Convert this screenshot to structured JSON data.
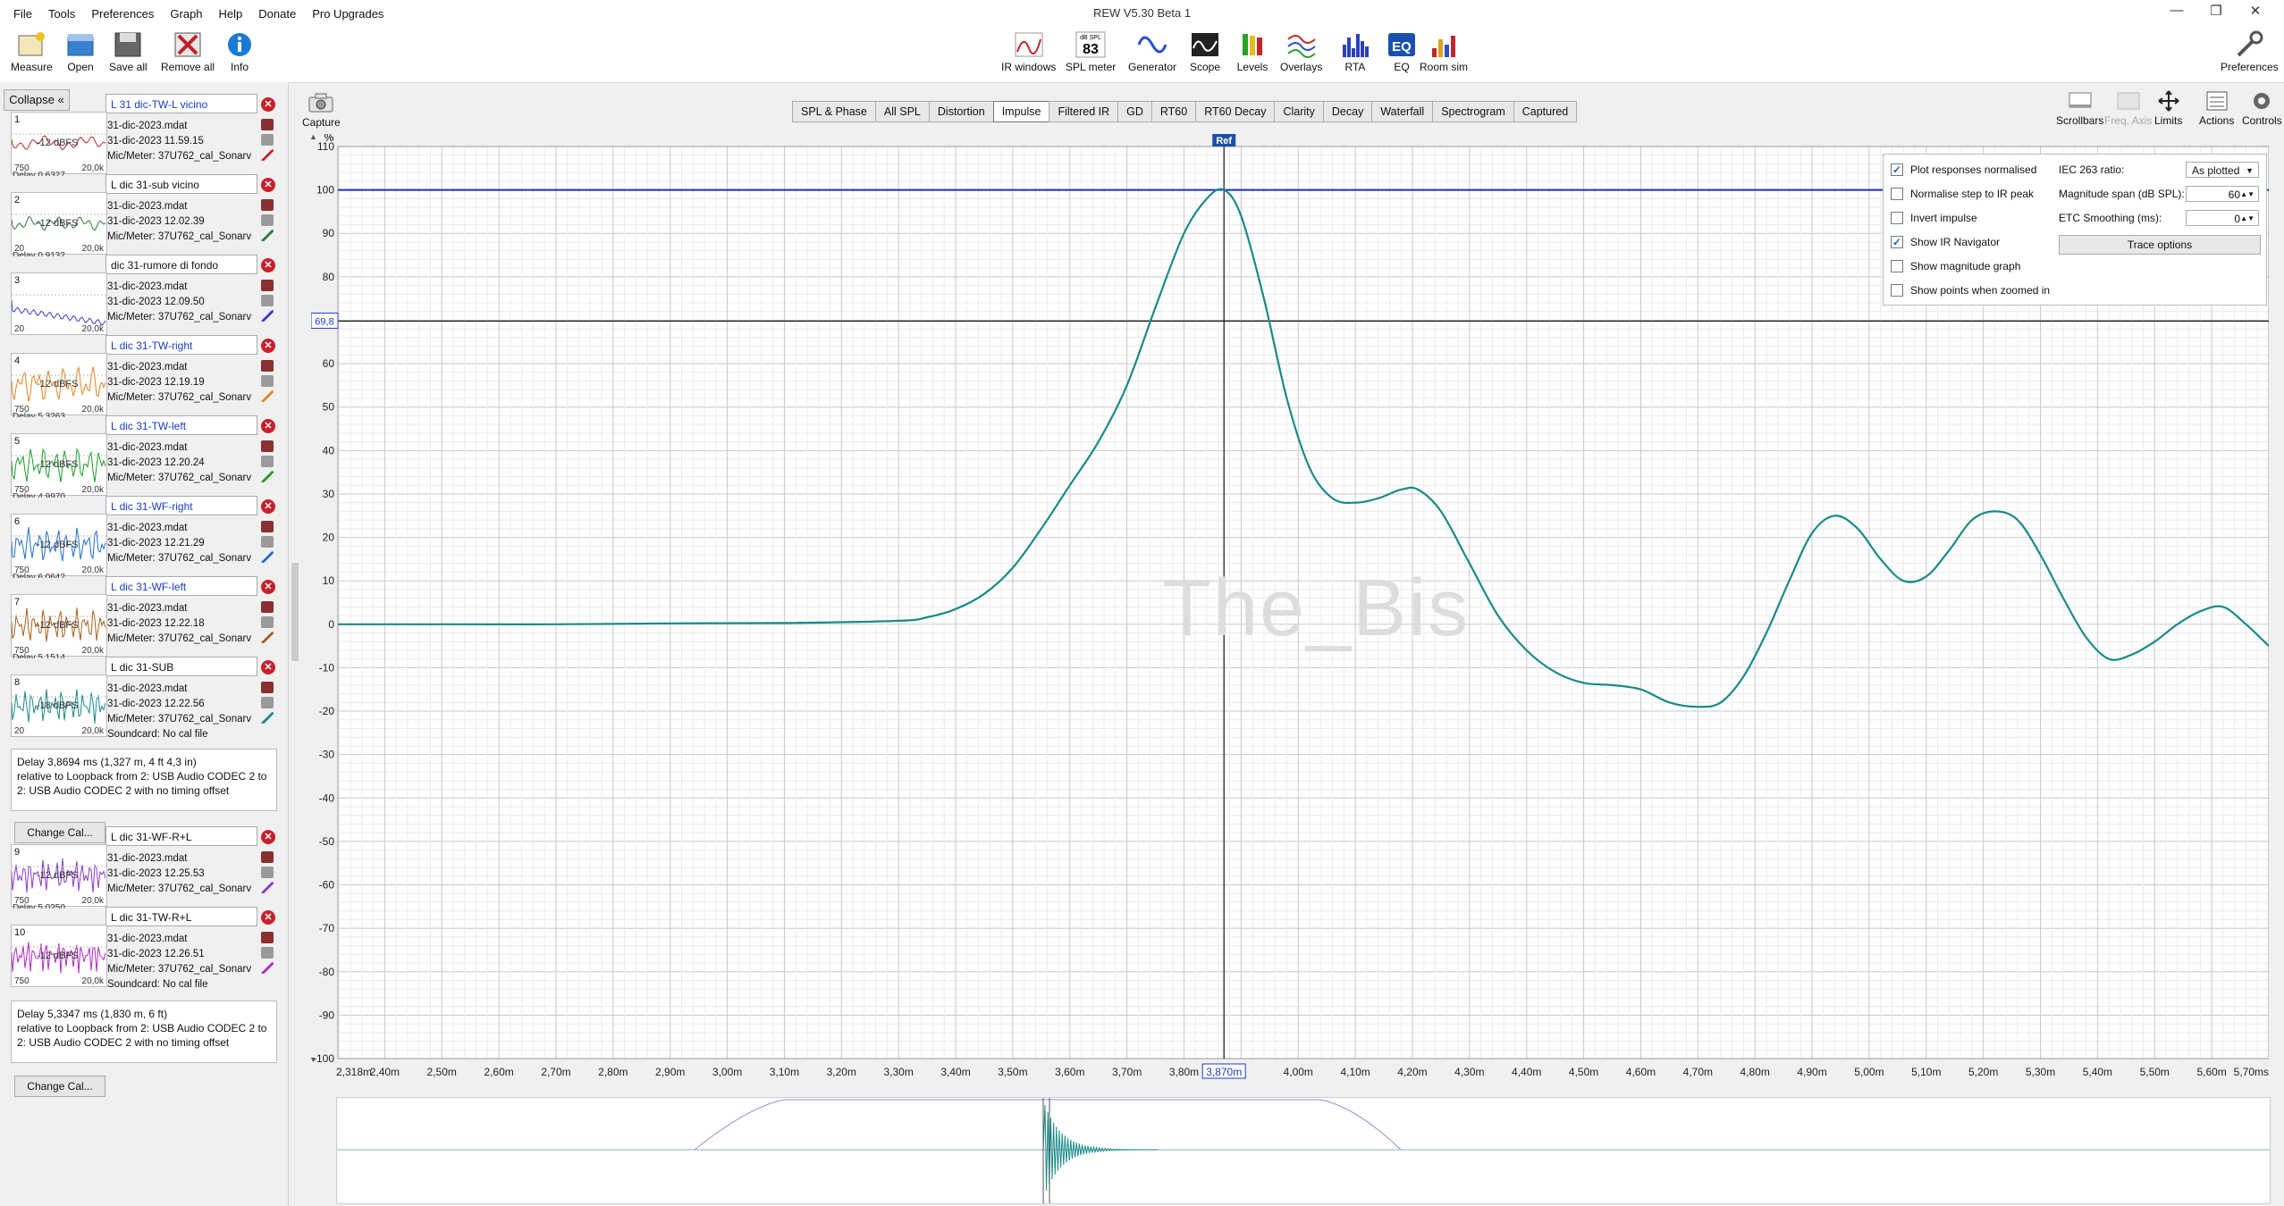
{
  "window": {
    "title": "REW V5.30 Beta 1",
    "controls": [
      "—",
      "❐",
      "✕"
    ]
  },
  "menu": [
    "File",
    "Tools",
    "Preferences",
    "Graph",
    "Help",
    "Donate",
    "Pro Upgrades"
  ],
  "toolbar_left": [
    {
      "label": "Measure",
      "icon": "measure-icon"
    },
    {
      "label": "Open",
      "icon": "open-icon"
    },
    {
      "label": "Save all",
      "icon": "save-icon"
    },
    {
      "label": "Remove all",
      "icon": "remove-icon"
    },
    {
      "label": "Info",
      "icon": "info-icon"
    }
  ],
  "toolbar_center": [
    {
      "label": "IR windows",
      "icon": "ir-windows-icon"
    },
    {
      "label": "SPL meter",
      "icon": "spl-meter-icon",
      "value": "83",
      "unit": "dB SPL"
    },
    {
      "label": "Generator",
      "icon": "generator-icon"
    },
    {
      "label": "Scope",
      "icon": "scope-icon"
    },
    {
      "label": "Levels",
      "icon": "levels-icon"
    },
    {
      "label": "Overlays",
      "icon": "overlays-icon"
    },
    {
      "label": "RTA",
      "icon": "rta-icon"
    },
    {
      "label": "EQ",
      "icon": "eq-icon"
    },
    {
      "label": "Room sim",
      "icon": "room-sim-icon"
    }
  ],
  "toolbar_right": {
    "label": "Preferences",
    "icon": "preferences-icon"
  },
  "left_panel": {
    "collapse_label": "Collapse",
    "collapse_icon": "«",
    "change_cal_label": "Change Cal...",
    "measurements": [
      {
        "num": "1",
        "name": "L 31 dic-TW-L vicino",
        "blue": true,
        "color": "#c0262c",
        "dbfs": "-12 dBFS",
        "ax_l": "750",
        "ax_r": "20,0k",
        "file": "31-dic-2023.mdat",
        "date": "31-dic-2023 11.59.15",
        "mic": "Mic/Meter: 37U762_cal_Sonarv",
        "delay": "Delay 0,6327"
      },
      {
        "num": "2",
        "name": "L dic 31-sub vicino",
        "blue": false,
        "color": "#2c7a3a",
        "dbfs": "-12 dBFS",
        "ax_l": "20",
        "ax_r": "20,0k",
        "file": "31-dic-2023.mdat",
        "date": "31-dic-2023 12.02.39",
        "mic": "Mic/Meter: 37U762_cal_Sonarv",
        "delay": "Delay 0,9132"
      },
      {
        "num": "3",
        "name": "dic 31-rumore di fondo",
        "blue": false,
        "color": "#3a3ad0",
        "dbfs": "",
        "ax_l": "20",
        "ax_r": "20,0k",
        "file": "31-dic-2023.mdat",
        "date": "31-dic-2023 12.09.50",
        "mic": "Mic/Meter: 37U762_cal_Sonarv",
        "delay": ""
      },
      {
        "num": "4",
        "name": "L dic 31-TW-right",
        "blue": true,
        "color": "#e8821e",
        "dbfs": "-12 dBFS",
        "ax_l": "750",
        "ax_r": "20,0k",
        "file": "31-dic-2023.mdat",
        "date": "31-dic-2023 12.19.19",
        "mic": "Mic/Meter: 37U762_cal_Sonarv",
        "delay": "Delay 5,3263"
      },
      {
        "num": "5",
        "name": "L dic 31-TW-left",
        "blue": true,
        "color": "#1e9c2a",
        "dbfs": "-12 dBFS",
        "ax_l": "750",
        "ax_r": "20,0k",
        "file": "31-dic-2023.mdat",
        "date": "31-dic-2023 12.20.24",
        "mic": "Mic/Meter: 37U762_cal_Sonarv",
        "delay": "Delay 4,9970"
      },
      {
        "num": "6",
        "name": "L dic 31-WF-right",
        "blue": true,
        "color": "#1e6ed0",
        "dbfs": "-12 dBFS",
        "ax_l": "750",
        "ax_r": "20,0k",
        "file": "31-dic-2023.mdat",
        "date": "31-dic-2023 12.21.29",
        "mic": "Mic/Meter: 37U762_cal_Sonarv",
        "delay": "Delay 6,0642"
      },
      {
        "num": "7",
        "name": "L dic 31-WF-left",
        "blue": true,
        "color": "#a8601e",
        "dbfs": "-12 dBFS",
        "ax_l": "750",
        "ax_r": "20,0k",
        "file": "31-dic-2023.mdat",
        "date": "31-dic-2023 12.22.18",
        "mic": "Mic/Meter: 37U762_cal_Sonarv",
        "delay": "Delay 5,1514"
      },
      {
        "num": "8",
        "name": "L dic 31-SUB",
        "blue": false,
        "color": "#1a8a8a",
        "dbfs": "-18 dBFS",
        "ax_l": "20",
        "ax_r": "20,0k",
        "file": "31-dic-2023.mdat",
        "date": "31-dic-2023 12.22.56",
        "mic": "Mic/Meter: 37U762_cal_Sonarv",
        "soundcard": "Soundcard: No cal file",
        "delay": ""
      },
      {
        "num": "9",
        "name": "L dic 31-WF-R+L",
        "blue": false,
        "color": "#8a3ad0",
        "dbfs": "-12 dBFS",
        "ax_l": "750",
        "ax_r": "20,0k",
        "file": "31-dic-2023.mdat",
        "date": "31-dic-2023 12.25.53",
        "mic": "Mic/Meter: 37U762_cal_Sonarv",
        "delay": "Delay 5,0250"
      },
      {
        "num": "10",
        "name": "L dic 31-TW-R+L",
        "blue": false,
        "color": "#b02ac0",
        "dbfs": "-12 dBFS",
        "ax_l": "750",
        "ax_r": "20,0k",
        "file": "31-dic-2023.mdat",
        "date": "31-dic-2023 12.26.51",
        "mic": "Mic/Meter: 37U762_cal_Sonarv",
        "soundcard": "Soundcard: No cal file",
        "delay": ""
      }
    ],
    "detail_8": [
      "Delay 3,8694 ms (1,327 m, 4 ft 4,3 in)",
      " relative to Loopback from 2: USB Audio CODEC  2 to",
      "2: USB Audio CODEC  2 with no timing offset"
    ],
    "detail_10": [
      "Delay 5,3347 ms (1,830 m, 6 ft)",
      " relative to Loopback from 2: USB Audio CODEC  2 to",
      "2: USB Audio CODEC  2 with no timing offset"
    ]
  },
  "capture_label": "Capture",
  "tabs": [
    "SPL & Phase",
    "All SPL",
    "Distortion",
    "Impulse",
    "Filtered IR",
    "GD",
    "RT60",
    "RT60 Decay",
    "Clarity",
    "Decay",
    "Waterfall",
    "Spectrogram",
    "Captured"
  ],
  "active_tab": "Impulse",
  "right_tools": [
    {
      "label": "Scrollbars",
      "icon": "scrollbars-icon",
      "disabled": false
    },
    {
      "label": "Freq. Axis",
      "icon": "freq-axis-icon",
      "disabled": true
    },
    {
      "label": "Limits",
      "icon": "limits-icon",
      "disabled": false
    },
    {
      "label": "Actions",
      "icon": "actions-icon",
      "disabled": false
    },
    {
      "label": "Controls",
      "icon": "controls-icon",
      "disabled": false
    }
  ],
  "options": {
    "left": [
      {
        "label": "Plot responses normalised",
        "checked": true
      },
      {
        "label": "Normalise step to IR peak",
        "checked": false
      },
      {
        "label": "Invert impulse",
        "checked": false
      },
      {
        "label": "Show IR Navigator",
        "checked": true
      },
      {
        "label": "Show magnitude graph",
        "checked": false
      },
      {
        "label": "Show points when zoomed in",
        "checked": false
      }
    ],
    "iec_label": "IEC 263 ratio:",
    "iec_value": "As plotted",
    "mag_label": "Magnitude span (dB SPL):",
    "mag_value": "60",
    "etc_label": "ETC Smoothing (ms):",
    "etc_value": "0",
    "trace_button": "Trace options"
  },
  "watermark": "The_Bis",
  "chart_data": {
    "type": "line",
    "ylabel": "%",
    "ylim": [
      -100,
      110
    ],
    "xlim": [
      2.318,
      5.7
    ],
    "y_ticks": [
      110,
      100,
      90,
      80,
      70,
      60,
      50,
      40,
      30,
      20,
      10,
      0,
      -10,
      -20,
      -30,
      -40,
      -50,
      -60,
      -70,
      -80,
      -90,
      -100
    ],
    "x_ticks": [
      "2,318m",
      "2,40m",
      "2,50m",
      "2,60m",
      "2,70m",
      "2,80m",
      "2,90m",
      "3,00m",
      "3,10m",
      "3,20m",
      "3,30m",
      "3,40m",
      "3,50m",
      "3,60m",
      "3,70m",
      "3,80m",
      "3,870m",
      "4,00m",
      "4,10m",
      "4,20m",
      "4,30m",
      "4,40m",
      "4,50m",
      "4,60m",
      "4,70m",
      "4,80m",
      "4,90m",
      "5,00m",
      "5,10m",
      "5,20m",
      "5,30m",
      "5,40m",
      "5,50m",
      "5,60m",
      "5,70ms"
    ],
    "x_tick_values": [
      2.318,
      2.4,
      2.5,
      2.6,
      2.7,
      2.8,
      2.9,
      3.0,
      3.1,
      3.2,
      3.3,
      3.4,
      3.5,
      3.6,
      3.7,
      3.8,
      3.87,
      4.0,
      4.1,
      4.2,
      4.3,
      4.4,
      4.5,
      4.6,
      4.7,
      4.8,
      4.9,
      5.0,
      5.1,
      5.2,
      5.3,
      5.4,
      5.5,
      5.6,
      5.7
    ],
    "cursor_label": "3,870m",
    "ref_label": "Ref",
    "ref_x": 3.87,
    "hline_value": 100,
    "cursor_y_label": "69,8",
    "cursor_y": 69.8,
    "series": [
      {
        "color": "#1a8a8a",
        "x": [
          2.318,
          2.5,
          2.7,
          2.9,
          3.1,
          3.3,
          3.35,
          3.4,
          3.45,
          3.5,
          3.55,
          3.6,
          3.65,
          3.7,
          3.75,
          3.8,
          3.84,
          3.87,
          3.9,
          3.94,
          3.98,
          4.02,
          4.06,
          4.1,
          4.14,
          4.18,
          4.21,
          4.25,
          4.3,
          4.35,
          4.4,
          4.45,
          4.5,
          4.55,
          4.6,
          4.65,
          4.7,
          4.74,
          4.78,
          4.82,
          4.86,
          4.9,
          4.94,
          4.98,
          5.02,
          5.06,
          5.1,
          5.14,
          5.18,
          5.22,
          5.26,
          5.3,
          5.34,
          5.38,
          5.42,
          5.46,
          5.5,
          5.54,
          5.58,
          5.62,
          5.66,
          5.7
        ],
        "y": [
          0,
          0,
          0,
          0.2,
          0.3,
          0.8,
          1.6,
          3.5,
          7,
          13,
          22,
          32,
          42,
          55,
          73,
          90,
          98,
          100,
          94,
          75,
          52,
          36,
          29,
          28,
          29,
          31,
          31,
          26,
          14,
          2,
          -6,
          -11,
          -13.5,
          -14,
          -15,
          -18,
          -19,
          -18,
          -12,
          -2,
          10,
          21,
          25,
          22,
          15,
          10,
          11,
          17,
          24,
          26,
          24,
          16,
          6,
          -3,
          -8,
          -7,
          -4,
          0,
          3,
          4,
          0,
          -5
        ]
      }
    ]
  }
}
